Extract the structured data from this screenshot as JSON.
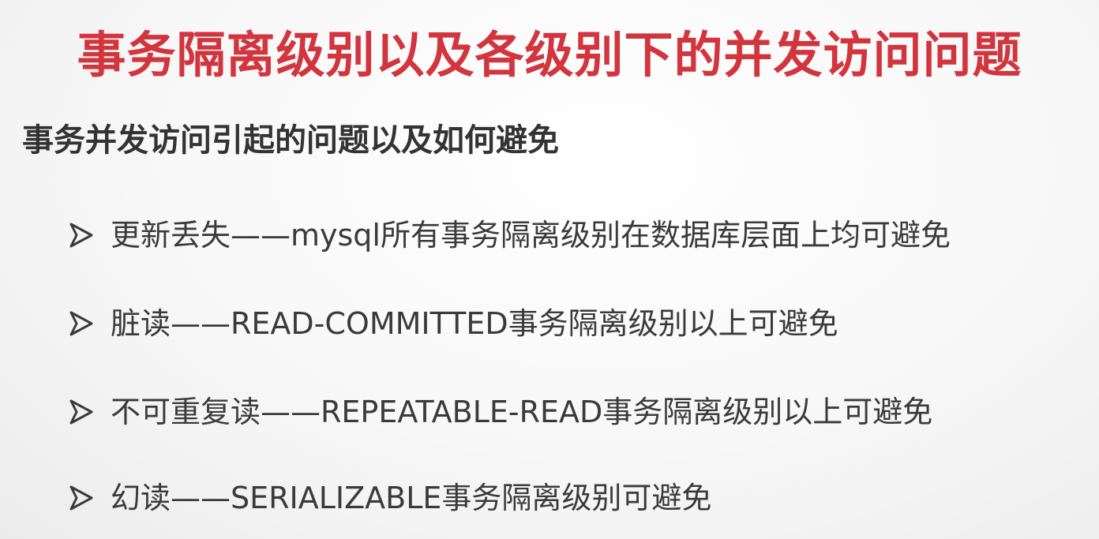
{
  "slide": {
    "title": "事务隔离级别以及各级别下的并发访问问题",
    "subtitle": "事务并发访问引起的问题以及如何避免",
    "bullets": [
      "更新丢失——mysql所有事务隔离级别在数据库层面上均可避免",
      "脏读——READ-COMMITTED事务隔离级别以上可避免",
      "不可重复读——REPEATABLE-READ事务隔离级别以上可避免",
      "幻读——SERIALIZABLE事务隔离级别可避免"
    ],
    "bullet_icon": "arrow-bullet-icon",
    "colors": {
      "title": "#d2353e",
      "text": "#3a3a3a"
    }
  }
}
